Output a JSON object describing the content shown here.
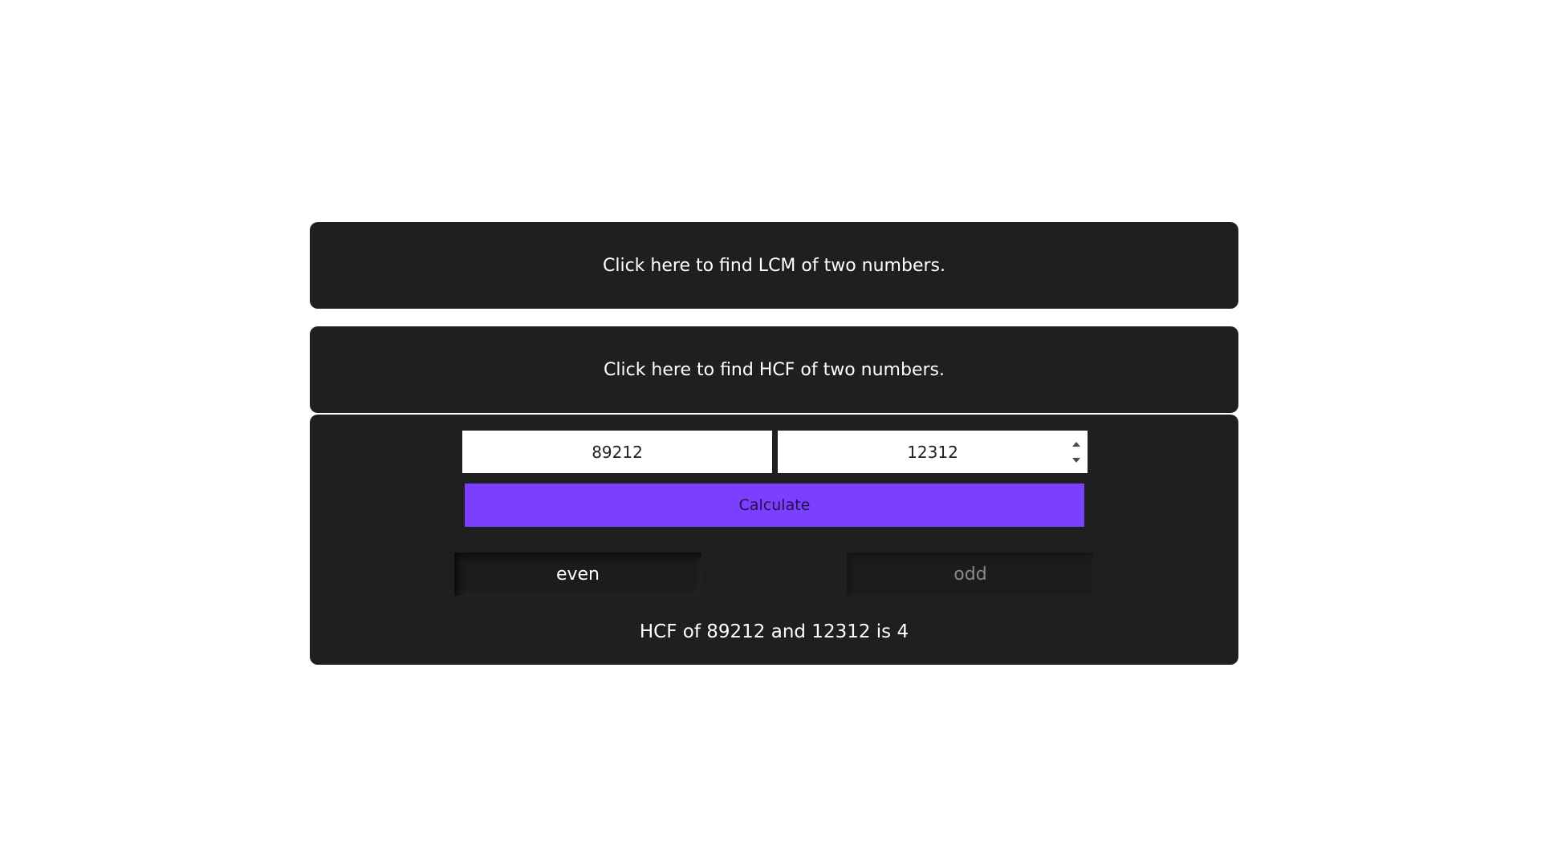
{
  "lcm_bar": {
    "label": "Click here to find LCM of two numbers."
  },
  "hcf_bar": {
    "label": "Click here to find HCF of two numbers."
  },
  "calculator": {
    "first_number": "89212",
    "second_number": "12312",
    "calculate_label": "Calculate",
    "even_label": "even",
    "odd_label": "odd",
    "result": "HCF of 89212 and 12312 is 4"
  },
  "colors": {
    "panel_bg": "#1f1f1f",
    "accent": "#7b40ff"
  }
}
